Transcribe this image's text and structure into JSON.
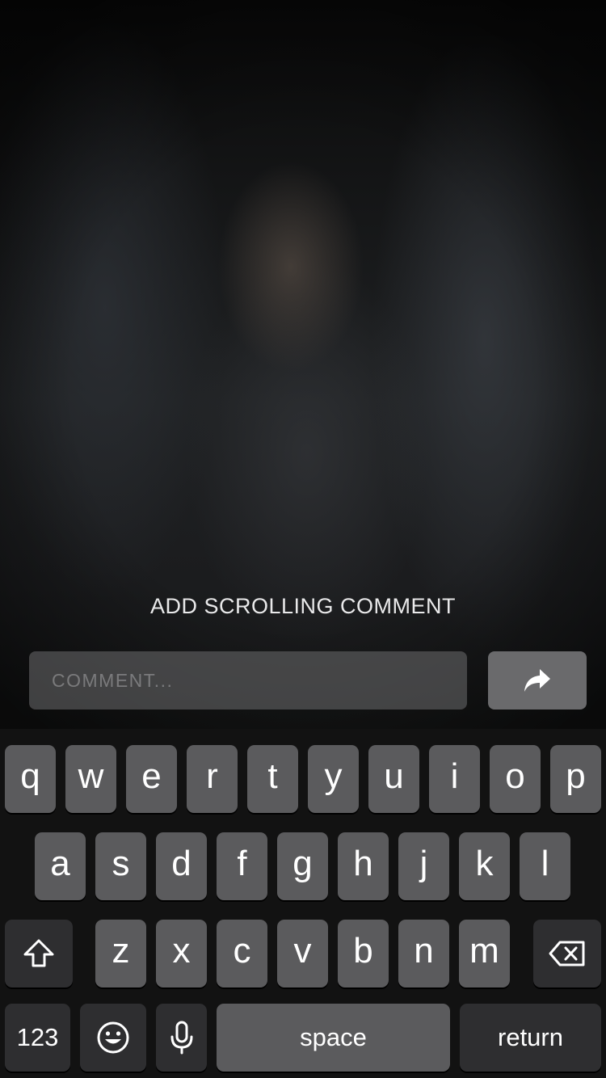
{
  "comment_panel": {
    "title": "ADD SCROLLING COMMENT",
    "input_placeholder": "COMMENT...",
    "input_value": ""
  },
  "send_button": {
    "icon": "share-arrow-icon"
  },
  "keyboard": {
    "row1": [
      "q",
      "w",
      "e",
      "r",
      "t",
      "y",
      "u",
      "i",
      "o",
      "p"
    ],
    "row2": [
      "a",
      "s",
      "d",
      "f",
      "g",
      "h",
      "j",
      "k",
      "l"
    ],
    "row3": [
      "z",
      "x",
      "c",
      "v",
      "b",
      "n",
      "m"
    ],
    "shift_icon": "shift-arrow-icon",
    "delete_icon": "backspace-icon",
    "numbers_label": "123",
    "emoji_icon": "emoji-icon",
    "mic_icon": "microphone-icon",
    "space_label": "space",
    "return_label": "return",
    "colors": {
      "letter_key": "#5b5b5d",
      "function_key": "#2e2e30",
      "keyboard_bg": "#121212"
    }
  }
}
